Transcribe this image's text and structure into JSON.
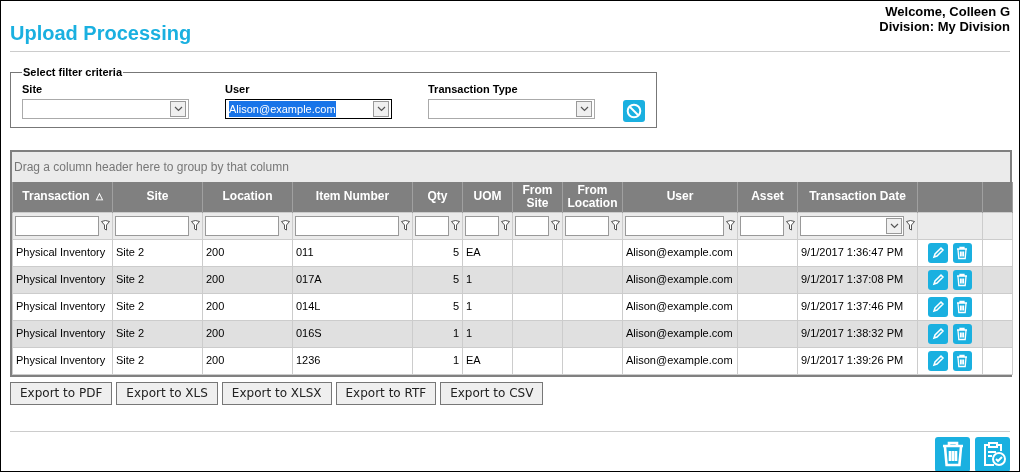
{
  "page": {
    "title": "Upload Processing",
    "welcome": "Welcome, Colleen G",
    "division": "Division: My Division"
  },
  "filter": {
    "legend": "Select filter criteria",
    "fields": [
      {
        "label": "Site",
        "text_selected": false
      },
      {
        "label": "User",
        "value": "Alison@example.com",
        "text_selected": true
      },
      {
        "label": "Transaction Type",
        "text_selected": false
      }
    ]
  },
  "grid": {
    "group_hint": "Drag a column header here to group by that column",
    "columns": [
      {
        "label": "Transaction",
        "sort_indicator": "△",
        "kind": "text"
      },
      {
        "label": "Site",
        "kind": "text"
      },
      {
        "label": "Location",
        "kind": "text"
      },
      {
        "label": "Item Number",
        "kind": "text"
      },
      {
        "label": "Qty",
        "kind": "number"
      },
      {
        "label": "UOM",
        "kind": "text"
      },
      {
        "label": "From Site",
        "kind": "text"
      },
      {
        "label": "From Location",
        "kind": "text"
      },
      {
        "label": "User",
        "kind": "text"
      },
      {
        "label": "Asset",
        "kind": "text"
      },
      {
        "label": "Transaction Date",
        "kind": "date"
      }
    ],
    "rows": [
      {
        "cells": [
          "Physical Inventory",
          "Site 2",
          "200",
          "011",
          "5",
          "EA",
          null,
          null,
          "Alison@example.com",
          null,
          "9/1/2017 1:36:47 PM"
        ]
      },
      {
        "cells": [
          "Physical Inventory",
          "Site 2",
          "200",
          "017A",
          "5",
          "1",
          null,
          null,
          "Alison@example.com",
          null,
          "9/1/2017 1:37:08 PM"
        ]
      },
      {
        "cells": [
          "Physical Inventory",
          "Site 2",
          "200",
          "014L",
          "5",
          "1",
          null,
          null,
          "Alison@example.com",
          null,
          "9/1/2017 1:37:46 PM"
        ]
      },
      {
        "cells": [
          "Physical Inventory",
          "Site 2",
          "200",
          "016S",
          "1",
          "1",
          null,
          null,
          "Alison@example.com",
          null,
          "9/1/2017 1:38:32 PM"
        ]
      },
      {
        "cells": [
          "Physical Inventory",
          "Site 2",
          "200",
          "1236",
          "1",
          "EA",
          null,
          null,
          "Alison@example.com",
          null,
          "9/1/2017 1:39:26 PM"
        ]
      }
    ]
  },
  "export_buttons": [
    "Export to PDF",
    "Export to XLS",
    "Export to XLSX",
    "Export to RTF",
    "Export to CSV"
  ]
}
